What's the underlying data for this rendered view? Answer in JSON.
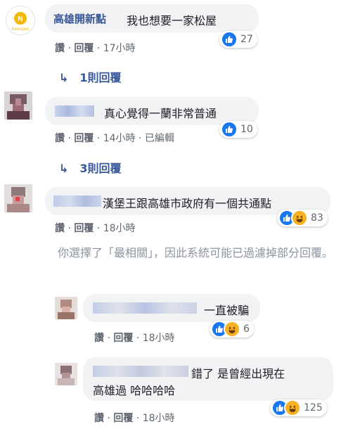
{
  "comments": [
    {
      "author": "高雄開新點",
      "text": "我也想要一家松屋",
      "actions": {
        "like": "讚",
        "reply": "回覆",
        "time": "17小時",
        "sep": "·"
      },
      "reactions": {
        "count": "27",
        "types": [
          "like"
        ]
      },
      "replies_label": "1則回覆"
    },
    {
      "author": "",
      "text": "真心覺得一蘭非常普通",
      "actions": {
        "like": "讚",
        "reply": "回覆",
        "time": "14小時",
        "sep": "·",
        "edited": "已編輯"
      },
      "reactions": {
        "count": "10",
        "types": [
          "like"
        ]
      },
      "replies_label": "3則回覆"
    },
    {
      "author": "",
      "text": "漢堡王跟高雄市政府有一個共通點",
      "actions": {
        "like": "讚",
        "reply": "回覆",
        "time": "18小時",
        "sep": "·"
      },
      "reactions": {
        "count": "83",
        "types": [
          "like",
          "haha"
        ]
      },
      "filter_note": "你選擇了「最相關」，因此系統可能已過濾掉部分回覆。",
      "replies": [
        {
          "author": "",
          "text": "一直被騙",
          "actions": {
            "like": "讚",
            "reply": "回覆",
            "time": "18小時",
            "sep": "·"
          },
          "reactions": {
            "count": "6",
            "types": [
              "like",
              "haha"
            ]
          }
        },
        {
          "author": "",
          "text_line1": "錯了 是曾經出現在",
          "text_line2": "高雄過 哈哈哈哈",
          "actions": {
            "like": "讚",
            "reply": "回覆",
            "time": "18小時",
            "sep": "·"
          },
          "reactions": {
            "count": "125",
            "types": [
              "like",
              "haha"
            ]
          }
        }
      ]
    }
  ],
  "icons": {
    "reply_arrow": "reply-arrow-icon",
    "like": "like-reaction-icon",
    "haha": "haha-reaction-icon",
    "page_logo_text": "Kewspen"
  },
  "colors": {
    "link": "#385898",
    "bubble": "#f2f3f5",
    "like": "#1877f2",
    "haha": "#f7b125",
    "muted": "#606770"
  }
}
